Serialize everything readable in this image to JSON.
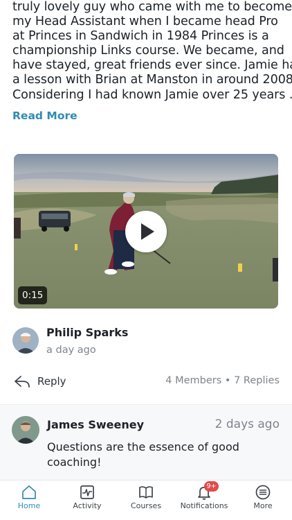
{
  "post": {
    "body_lines": [
      "truly lovely guy who came with me to become",
      "my Head Assistant when I became head Pro",
      "at Princes in Sandwich in 1984 Princes is a",
      "championship Links course. We became, and",
      "have stayed, great friends ever since. Jamie had",
      "a lesson with Brian at Manston in around 2008.",
      "Considering I had known Jamie over 25 years ..."
    ],
    "read_more_label": "Read More",
    "video": {
      "duration": "0:15"
    },
    "author": {
      "name": "Philip Sparks",
      "time": "a day ago"
    },
    "actions": {
      "reply_label": "Reply",
      "stats": "4 Members • 7 Replies"
    }
  },
  "reply": {
    "author": "James Sweeney",
    "time": "2 days ago",
    "text": "Questions are the essence of good coaching!"
  },
  "tabbar": {
    "tabs": [
      {
        "label": "Home",
        "icon": "home-icon",
        "active": true
      },
      {
        "label": "Activity",
        "icon": "activity-icon",
        "active": false
      },
      {
        "label": "Courses",
        "icon": "courses-icon",
        "active": false
      },
      {
        "label": "Notifications",
        "icon": "bell-icon",
        "active": false,
        "badge": "9+"
      },
      {
        "label": "More",
        "icon": "menu-icon",
        "active": false
      }
    ]
  },
  "colors": {
    "accent": "#2f8cb3",
    "badge": "#e04b4b",
    "muted_text": "#7d848c"
  }
}
